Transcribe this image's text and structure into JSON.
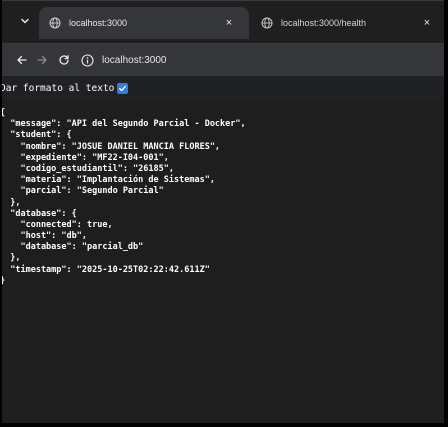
{
  "browser": {
    "tabs": [
      {
        "title": "localhost:3000",
        "active": true
      },
      {
        "title": "localhost:3000/health",
        "active": false
      }
    ],
    "close_glyph": "×",
    "address": "localhost:3000",
    "colors": {
      "tabstrip": "#1f1f1f",
      "active_tab": "#35363a",
      "toolbar": "#35363a",
      "page_background": "#1e1e1e",
      "checkbox_accent": "#2f7de1"
    }
  },
  "pretty_print": {
    "label": "Dar formato al texto",
    "checked": true
  },
  "json_lines": [
    "{",
    "  \"message\": \"API del Segundo Parcial - Docker\",",
    "  \"student\": {",
    "    \"nombre\": \"JOSUE DANIEL MANCIA FLORES\",",
    "    \"expediente\": \"MF22-I04-001\",",
    "    \"codigo_estudiantil\": \"26185\",",
    "    \"materia\": \"Implantación de Sistemas\",",
    "    \"parcial\": \"Segundo Parcial\"",
    "  },",
    "  \"database\": {",
    "    \"connected\": true,",
    "    \"host\": \"db\",",
    "    \"database\": \"parcial_db\"",
    "  },",
    "  \"timestamp\": \"2025-10-25T02:22:42.611Z\"",
    "}"
  ],
  "icons": {
    "tab_list": "chevron-down-icon",
    "tab_favicon": "globe-icon",
    "tab_close": "close-icon",
    "back": "arrow-left-icon",
    "forward": "arrow-right-icon",
    "reload": "reload-icon",
    "site_info": "info-icon",
    "checkbox": "check-icon"
  }
}
